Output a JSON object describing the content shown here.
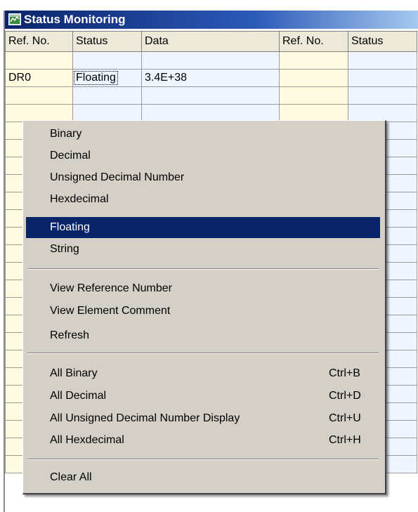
{
  "window": {
    "title": "Status Monitoring",
    "icon": "status-monitor-app-icon"
  },
  "grid": {
    "headers": [
      "Ref. No.",
      "Status",
      "Data",
      "Ref. No.",
      "Status"
    ],
    "rows": [
      [
        "",
        "",
        "",
        "",
        ""
      ],
      [
        "DR0",
        "Floating",
        "3.4E+38",
        "",
        ""
      ]
    ]
  },
  "context_menu": {
    "format_items": [
      {
        "label": "Binary"
      },
      {
        "label": "Decimal"
      },
      {
        "label": "Unsigned Decimal Number"
      },
      {
        "label": "Hexdecimal"
      },
      {
        "label": "Floating",
        "selected": true
      },
      {
        "label": "String"
      }
    ],
    "view_items": [
      {
        "label": "View Reference Number"
      },
      {
        "label": "View Element Comment"
      },
      {
        "label": "Refresh"
      }
    ],
    "all_items": [
      {
        "label": "All Binary",
        "shortcut": "Ctrl+B"
      },
      {
        "label": "All Decimal",
        "shortcut": "Ctrl+D"
      },
      {
        "label": "All Unsigned Decimal Number Display",
        "shortcut": "Ctrl+U"
      },
      {
        "label": "All Hexdecimal",
        "shortcut": "Ctrl+H"
      }
    ],
    "clear_items": [
      {
        "label": "Clear All"
      }
    ]
  },
  "colors": {
    "title_bar": "#0a246a",
    "menu_bg": "#d4d0c8",
    "menu_highlight": "#0a246a",
    "ref_column_bg": "#fffbe1",
    "value_column_bg": "#eef5ff"
  }
}
